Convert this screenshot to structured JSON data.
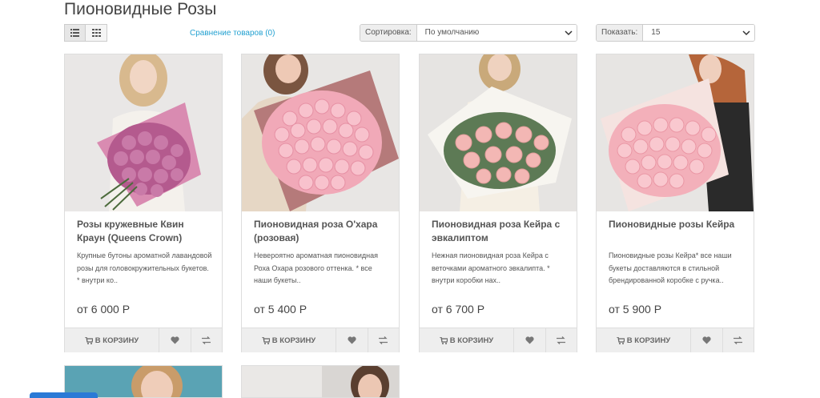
{
  "header": {
    "title": "Пионовидные Розы"
  },
  "toolbar": {
    "list_view_icon": "list-view-icon",
    "grid_view_icon": "grid-view-icon",
    "compare_link": "Сравнение товаров (0)",
    "sort_label": "Сортировка:",
    "sort_value": "По умолчанию",
    "show_label": "Показать:",
    "show_value": "15"
  },
  "products": [
    {
      "name": "Розы кружевные Квин Краун (Queens Crown)",
      "description": "Крупные бутоны ароматной лавандовой розы для головокружительных букетов. *  внутри ко..",
      "price": "от  6 000 Р",
      "cart_label": "В КОРЗИНУ"
    },
    {
      "name": "Пионовидная роза О'хара (розовая)",
      "description": "Невероятно ароматная пионовидная Роха Охара розового оттенка. *  все наши букеты..",
      "price": "от  5 400 Р",
      "cart_label": "В КОРЗИНУ"
    },
    {
      "name": "Пионовидная роза Кейра с эвкалиптом",
      "description": "Нежная пионовидная роза Кейра с веточками ароматного эвкалипта. *  внутри коробки нах..",
      "price": "от  6 700 Р",
      "cart_label": "В КОРЗИНУ"
    },
    {
      "name": "Пионовидные розы Кейра",
      "description": "Пионовидные розы Кейра*  все наши букеты доставляются в стильной брендированной коробке с ручка..",
      "price": "от  5 900 Р",
      "cart_label": "В КОРЗИНУ"
    }
  ],
  "icons": {
    "cart": "cart-icon",
    "wishlist": "heart-icon",
    "compare": "compare-icon"
  },
  "colors": {
    "link": "#23a1d1",
    "button_bg": "#eeeeee",
    "chat_button": "#2b7ad6"
  }
}
